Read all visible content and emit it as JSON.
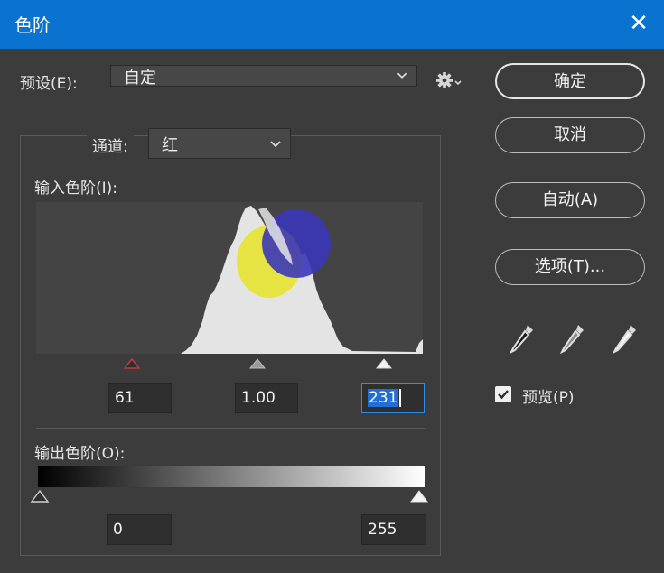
{
  "window": {
    "title": "色阶",
    "close_glyph": "✕"
  },
  "preset": {
    "label": "预设(E):",
    "value": "自定",
    "gear_icon": "gear-icon"
  },
  "buttons": {
    "ok": "确定",
    "cancel": "取消",
    "auto": "自动(A)",
    "options": "选项(T)..."
  },
  "channel": {
    "label": "通道:",
    "value": "红"
  },
  "input_levels": {
    "label": "输入色阶(I):",
    "shadow": "61",
    "midtone": "1.00",
    "highlight": "231",
    "shadow_level": 61,
    "midtone_level": 1.0,
    "highlight_level": 231
  },
  "output_levels": {
    "label": "输出色阶(O):",
    "low": "0",
    "high": "255",
    "low_level": 0,
    "high_level": 255
  },
  "preview": {
    "label": "预览(P)",
    "checked": true
  },
  "colors": {
    "titlebar": "#0a72cf",
    "panel": "#3c3c3c",
    "histogram_bg": "#444444",
    "histogram_fill": "#e4e4e4",
    "focus": "#2d8ceb"
  }
}
